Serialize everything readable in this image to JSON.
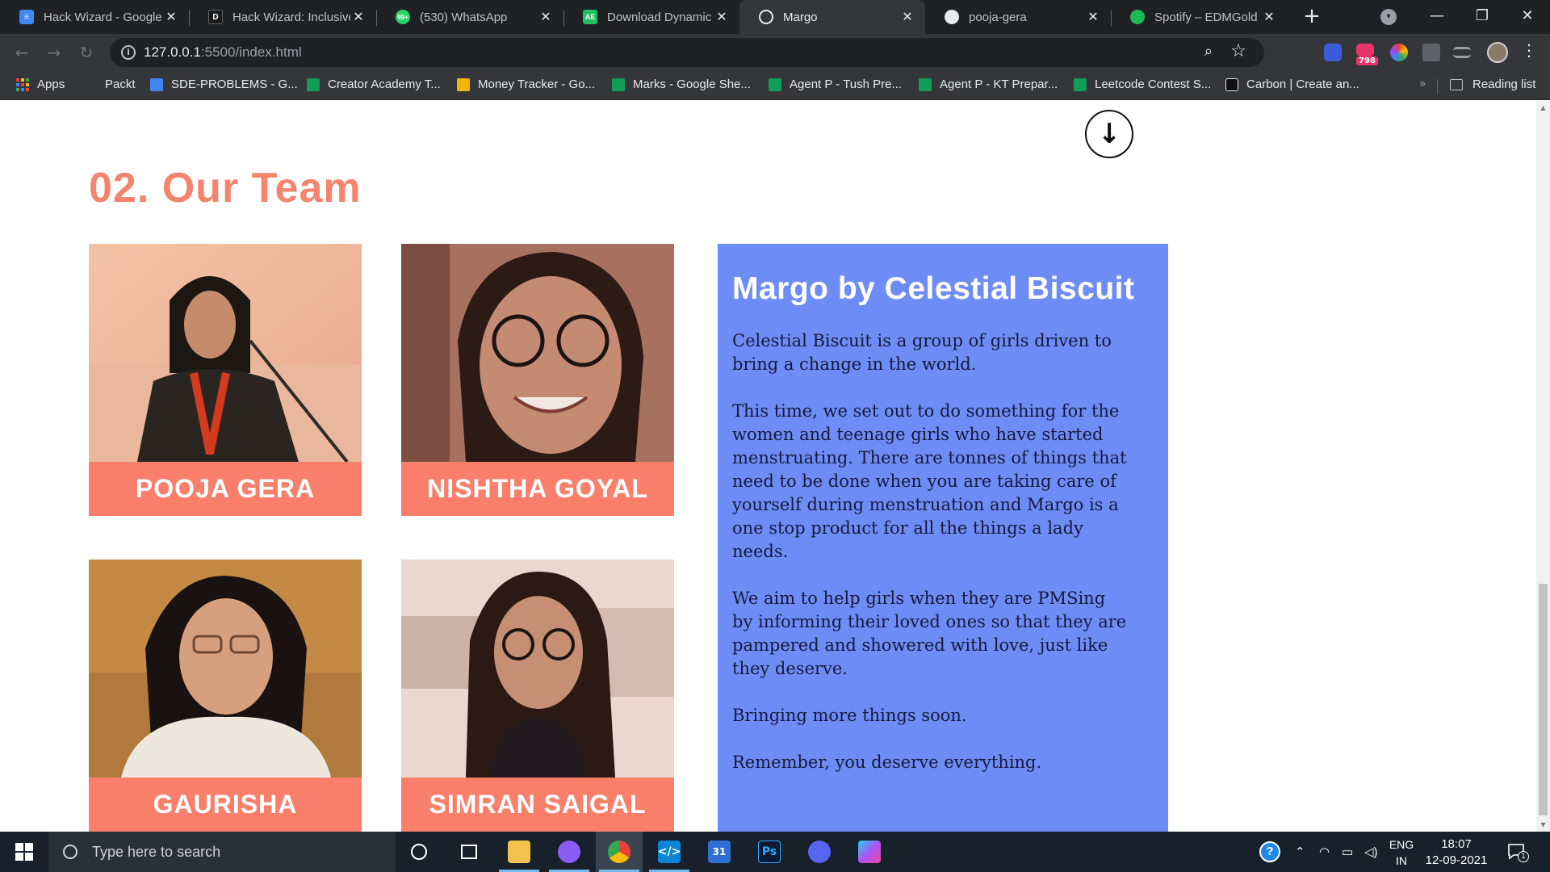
{
  "browser": {
    "tabs": [
      {
        "title": "Hack Wizard - Google",
        "icon": "google-docs-icon",
        "color": "#4285f4",
        "glyph": "≡"
      },
      {
        "title": "Hack Wizard: Inclusive",
        "icon": "devpost-icon",
        "color": "#1a1a1a",
        "glyph": "D"
      },
      {
        "title": "(530) WhatsApp",
        "icon": "whatsapp-icon",
        "color": "#25d366",
        "glyph": "99+"
      },
      {
        "title": "Download Dynamic w",
        "icon": "ae-icon",
        "color": "#1fbf5f",
        "glyph": "AE"
      },
      {
        "title": "Margo",
        "icon": "globe-icon",
        "color": "#5f6368",
        "glyph": "◎"
      },
      {
        "title": "pooja-gera",
        "icon": "github-icon",
        "color": "#e8eaed",
        "glyph": "●"
      },
      {
        "title": "Spotify – EDMGold",
        "icon": "spotify-icon",
        "color": "#1db954",
        "glyph": "≋"
      }
    ],
    "url_host": "127.0.0.1",
    "url_path": ":5500/index.html",
    "ext_badge": "798",
    "bookmarks": [
      {
        "label": "Apps",
        "icon": "apps-grid-icon",
        "color": "#ea4335"
      },
      {
        "label": "Packt",
        "icon": "packt-icon",
        "color": "#35363a"
      },
      {
        "label": "SDE-PROBLEMS - G...",
        "icon": "google-docs-icon",
        "color": "#4285f4"
      },
      {
        "label": "Creator Academy T...",
        "icon": "google-sheets-icon",
        "color": "#0f9d58"
      },
      {
        "label": "Money Tracker - Go...",
        "icon": "google-slides-icon",
        "color": "#f4b400"
      },
      {
        "label": "Marks - Google She...",
        "icon": "google-sheets-icon",
        "color": "#0f9d58"
      },
      {
        "label": "Agent P - Tush Pre...",
        "icon": "google-sheets-icon",
        "color": "#0f9d58"
      },
      {
        "label": "Agent P - KT Prepar...",
        "icon": "google-sheets-icon",
        "color": "#0f9d58"
      },
      {
        "label": "Leetcode Contest S...",
        "icon": "google-sheets-icon",
        "color": "#0f9d58"
      },
      {
        "label": "Carbon | Create an...",
        "icon": "carbon-icon",
        "color": "#111111"
      }
    ],
    "reading_list": "Reading list"
  },
  "page": {
    "section_title": "02. Our Team",
    "team": [
      {
        "name": "POOJA GERA"
      },
      {
        "name": "NISHTHA GOYAL"
      },
      {
        "name": "GAURISHA"
      },
      {
        "name": "SIMRAN SAIGAL"
      }
    ],
    "about": {
      "title": "Margo by Celestial Biscuit",
      "paragraphs": [
        "Celestial Biscuit is a group of girls driven to bring a change in the world.",
        "This time, we set out to do something for the women and teenage girls who have started menstruating. There are tonnes of things that need to be done when you are taking care of yourself during menstruation and Margo is a one stop product for all the things a lady needs.",
        "We aim to help girls when they are PMSing by informing their loved ones so that they are pampered and showered with love, just like they deserve.",
        "Bringing more things soon.",
        "Remember, you deserve everything."
      ]
    },
    "colors": {
      "title": "#f6836c",
      "nameplate": "#f97f6b",
      "about_bg": "#6e8cf5"
    }
  },
  "taskbar": {
    "search_placeholder": "Type here to search",
    "lang_top": "ENG",
    "lang_bottom": "IN",
    "time": "18:07",
    "date": "12-09-2021",
    "notification_count": "1"
  }
}
